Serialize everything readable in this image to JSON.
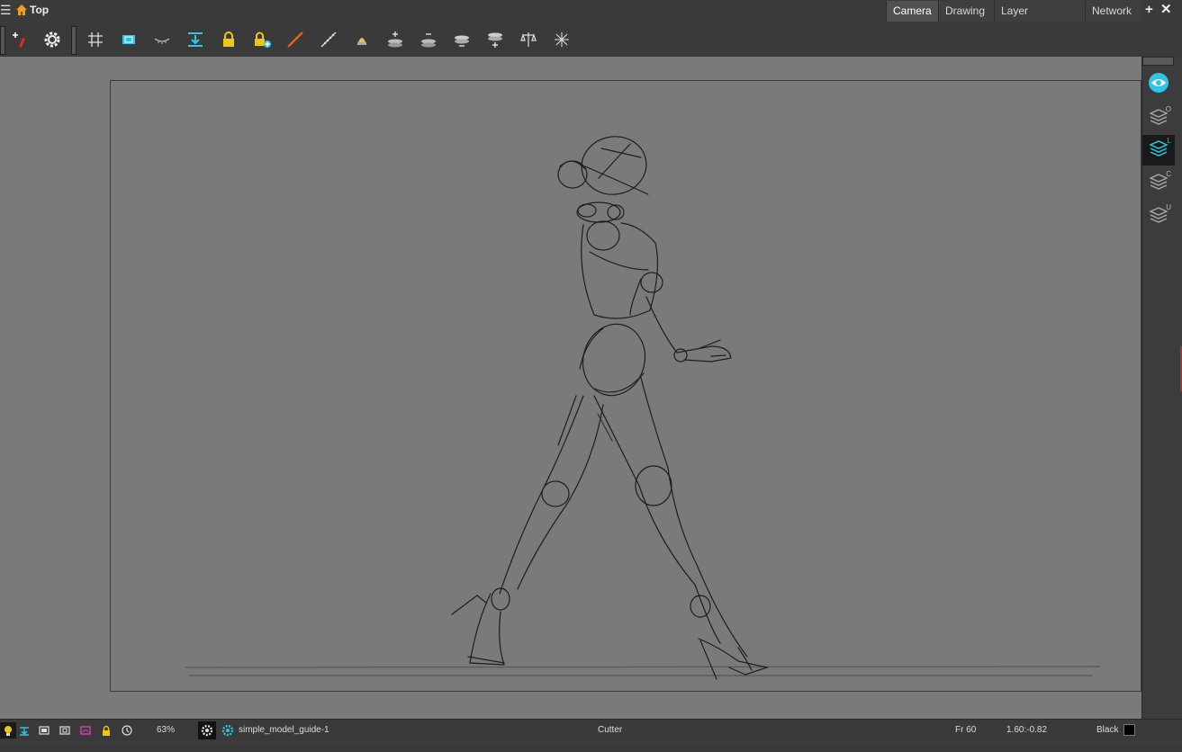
{
  "header": {
    "view_title": "Top",
    "tabs": [
      {
        "label": "Camera",
        "active": true
      },
      {
        "label": "Drawing",
        "active": false
      },
      {
        "label": "Layer Properties",
        "active": false
      },
      {
        "label": "Network",
        "active": false
      }
    ],
    "add_symbol": "+",
    "close_symbol": "✕"
  },
  "toolbar": {
    "icons": [
      "pencil-add-icon",
      "gear-icon",
      "grid-icon",
      "camera-safe-icon",
      "onion-skin-icon",
      "import-drawing-icon",
      "lock-icon",
      "lock-add-icon",
      "orange-ruler-icon",
      "white-ruler-icon",
      "lamp-icon",
      "layer-add-icon",
      "layer-remove-icon",
      "layer-stack-icon",
      "layer-stack-add-icon",
      "balance-icon",
      "scale-arrows-icon"
    ]
  },
  "status": {
    "zoom": "63%",
    "drawing_name": "simple_model_guide-1",
    "tool": "Cutter",
    "frame": "Fr 60",
    "coords": "1.60:-0.82",
    "color_name": "Black",
    "color_swatch": "#000000"
  },
  "sidebar": {
    "layer_badges": [
      "O",
      "L",
      "C",
      "U"
    ]
  },
  "colors": {
    "accent": "#2ec5e6",
    "orange": "#e8681f",
    "yellow": "#f2c511",
    "magenta": "#e03cc0"
  }
}
